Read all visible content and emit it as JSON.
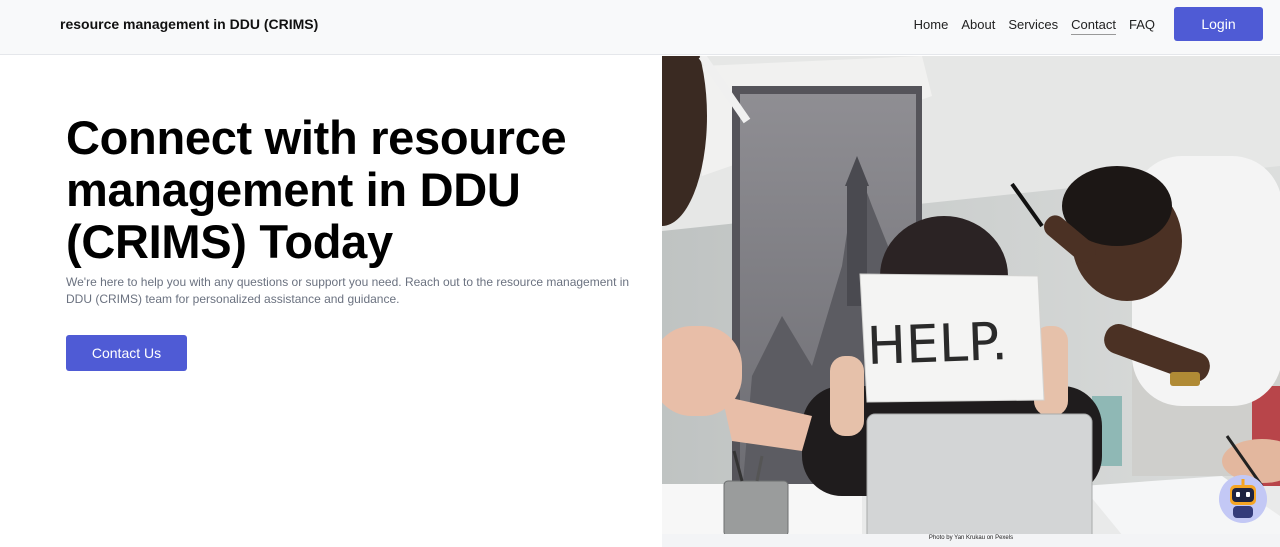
{
  "header": {
    "brand": "resource management in DDU (CRIMS)",
    "nav": [
      "Home",
      "About",
      "Services",
      "Contact",
      "FAQ"
    ],
    "login_label": "Login"
  },
  "hero": {
    "title": "Connect with resource management in DDU (CRIMS) Today",
    "subtitle": "We're here to help you with any questions or support you need. Reach out to the resource management in DDU (CRIMS) team for personalized assistance and guidance.",
    "cta_label": "Contact Us",
    "sign_text": "HELP.",
    "photo_credit": "Photo by Yan Krukau on Pexels"
  },
  "colors": {
    "accent": "#4f5bd5",
    "navbar_bg": "#f8f9fa",
    "subtitle": "#6b7280"
  },
  "icons": {
    "chat_bot": "robot-icon"
  }
}
